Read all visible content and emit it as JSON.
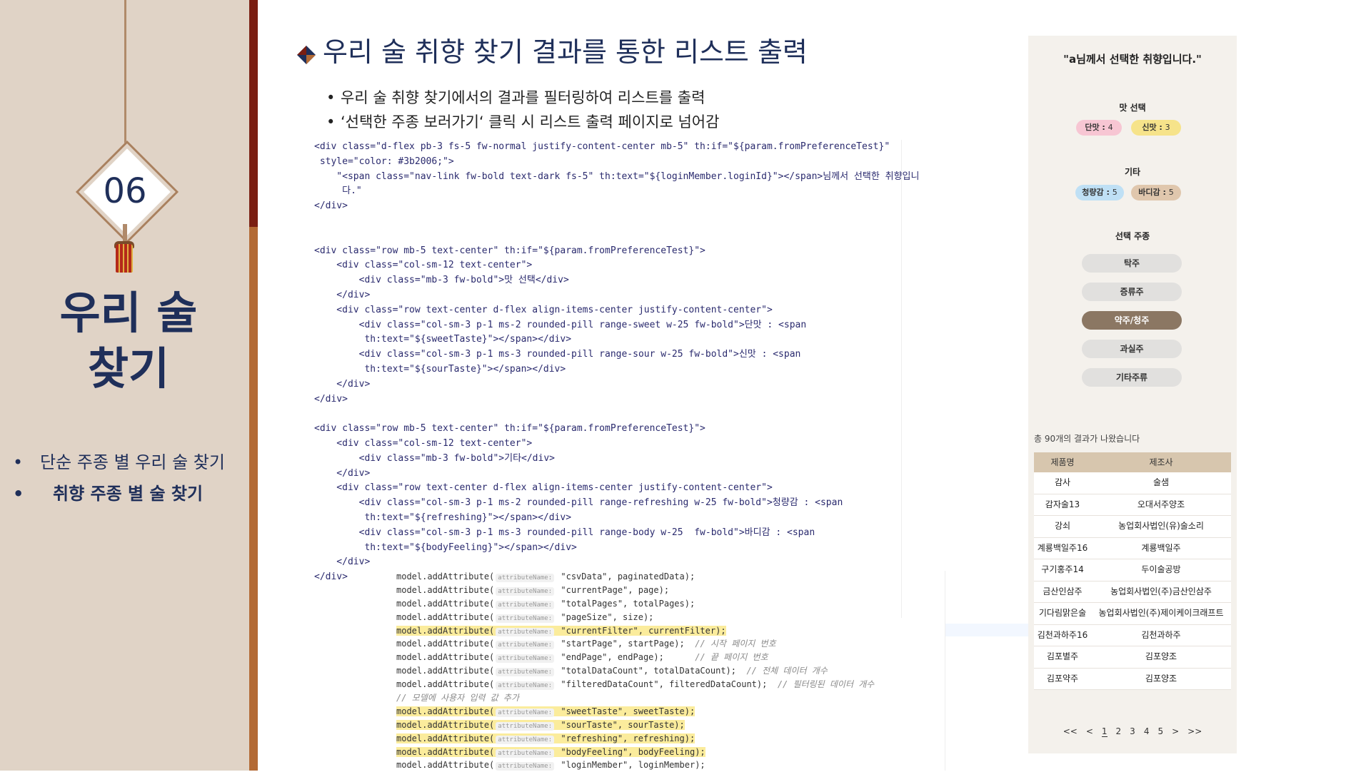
{
  "sidebar": {
    "badge": "06",
    "title_line1": "우리 술",
    "title_line2": "찾기",
    "menu": [
      {
        "label": "단순 주종 별 우리 술 찾기"
      },
      {
        "label": "취향 주종 별 술 찾기"
      }
    ]
  },
  "main": {
    "title": "우리 술 취향 찾기 결과를 통한 리스트 출력",
    "bullets": [
      "우리 술 취향 찾기에서의 결과를 필터링하여 리스트를 출력",
      "‘선택한 주종 보러가기‘ 클릭 시 리스트 출력 페이지로 넘어감"
    ]
  },
  "code_html": [
    "<div class=\"d-flex pb-3 fs-5 fw-normal justify-content-center mb-5\" th:if=\"${param.fromPreferenceTest}\"",
    " style=\"color: #3b2006;\">",
    "    \"<span class=\"nav-link fw-bold text-dark fs-5\" th:text=\"${loginMember.loginId}\"></span>님께서 선택한 취향입니",
    "     다.\"",
    "</div>",
    "",
    "",
    "<div class=\"row mb-5 text-center\" th:if=\"${param.fromPreferenceTest}\">",
    "    <div class=\"col-sm-12 text-center\">",
    "        <div class=\"mb-3 fw-bold\">맛 선택</div>",
    "    </div>",
    "    <div class=\"row text-center d-flex align-items-center justify-content-center\">",
    "        <div class=\"col-sm-3 p-1 ms-2 rounded-pill range-sweet w-25 fw-bold\">단맛 : <span",
    "         th:text=\"${sweetTaste}\"></span></div>",
    "        <div class=\"col-sm-3 p-1 ms-3 rounded-pill range-sour w-25 fw-bold\">신맛 : <span",
    "         th:text=\"${sourTaste}\"></span></div>",
    "    </div>",
    "</div>",
    "",
    "<div class=\"row mb-5 text-center\" th:if=\"${param.fromPreferenceTest}\">",
    "    <div class=\"col-sm-12 text-center\">",
    "        <div class=\"mb-3 fw-bold\">기타</div>",
    "    </div>",
    "    <div class=\"row text-center d-flex align-items-center justify-content-center\">",
    "        <div class=\"col-sm-3 p-1 ms-2 rounded-pill range-refreshing w-25 fw-bold\">청량감 : <span",
    "         th:text=\"${refreshing}\"></span></div>",
    "        <div class=\"col-sm-3 p-1 ms-3 rounded-pill range-body w-25  fw-bold\">바디감 : <span",
    "         th:text=\"${bodyFeeling}\"></span></div>",
    "    </div>",
    "</div>"
  ],
  "code_java": [
    {
      "pre": "model.addAttribute(",
      "tag": "attributeName:",
      "post": " \"csvData\", paginatedData);",
      "hl": false,
      "comment": ""
    },
    {
      "pre": "model.addAttribute(",
      "tag": "attributeName:",
      "post": " \"currentPage\", page);",
      "hl": false,
      "comment": ""
    },
    {
      "pre": "model.addAttribute(",
      "tag": "attributeName:",
      "post": " \"totalPages\", totalPages);",
      "hl": false,
      "comment": ""
    },
    {
      "pre": "model.addAttribute(",
      "tag": "attributeName:",
      "post": " \"pageSize\", size);",
      "hl": false,
      "comment": ""
    },
    {
      "pre": "model.addAttribute(",
      "tag": "attributeName:",
      "post": " \"currentFilter\", currentFilter);",
      "hl": true,
      "comment": ""
    },
    {
      "pre": "model.addAttribute(",
      "tag": "attributeName:",
      "post": " \"startPage\", startPage);  ",
      "hl": false,
      "comment": "// 시작 페이지 번호"
    },
    {
      "pre": "model.addAttribute(",
      "tag": "attributeName:",
      "post": " \"endPage\", endPage);      ",
      "hl": false,
      "comment": "// 끝 페이지 번호"
    },
    {
      "pre": "model.addAttribute(",
      "tag": "attributeName:",
      "post": " \"totalDataCount\", totalDataCount);  ",
      "hl": false,
      "comment": "// 전체 데이터 개수"
    },
    {
      "pre": "model.addAttribute(",
      "tag": "attributeName:",
      "post": " \"filteredDataCount\", filteredDataCount);  ",
      "hl": false,
      "comment": "// 필터링된 데이터 개수"
    },
    {
      "pre": "",
      "tag": "",
      "post": "",
      "hl": false,
      "comment": "// 모델에 사용자 입력 값 추가"
    },
    {
      "pre": "model.addAttribute(",
      "tag": "attributeName:",
      "post": " \"sweetTaste\", sweetTaste);",
      "hl": true,
      "comment": ""
    },
    {
      "pre": "model.addAttribute(",
      "tag": "attributeName:",
      "post": " \"sourTaste\", sourTaste);",
      "hl": true,
      "comment": ""
    },
    {
      "pre": "model.addAttribute(",
      "tag": "attributeName:",
      "post": " \"refreshing\", refreshing);",
      "hl": true,
      "comment": ""
    },
    {
      "pre": "model.addAttribute(",
      "tag": "attributeName:",
      "post": " \"bodyFeeling\", bodyFeeling);",
      "hl": true,
      "comment": ""
    },
    {
      "pre": "model.addAttribute(",
      "tag": "attributeName:",
      "post": " \"loginMember\", loginMember);",
      "hl": false,
      "comment": ""
    }
  ],
  "screenshot": {
    "header": "\"a님께서 선택한 취향입니다.\"",
    "taste_label": "맛 선택",
    "sweet": {
      "label": "단맛 : ",
      "value": "4",
      "color": "#f7c6d3"
    },
    "sour": {
      "label": "신맛 : ",
      "value": "3",
      "color": "#f6e38a"
    },
    "etc_label": "기타",
    "refreshing": {
      "label": "청량감 : ",
      "value": "5",
      "color": "#bfe0f5"
    },
    "body": {
      "label": "바디감 : ",
      "value": "5",
      "color": "#e0c7ad"
    },
    "type_label": "선택 주종",
    "types": [
      {
        "label": "탁주",
        "selected": false
      },
      {
        "label": "증류주",
        "selected": false
      },
      {
        "label": "약주/청주",
        "selected": true
      },
      {
        "label": "과실주",
        "selected": false
      },
      {
        "label": "기타주류",
        "selected": false
      }
    ],
    "count_text": "총 90개의 결과가 나왔습니다",
    "table_headers": [
      "제품명",
      "제조사"
    ],
    "rows": [
      [
        "감사",
        "술샘"
      ],
      [
        "감자술13",
        "오대서주양조"
      ],
      [
        "강쇠",
        "농업회사법인(유)술소리"
      ],
      [
        "계룡백일주16",
        "계룡백일주"
      ],
      [
        "구기홍주14",
        "두이술공방"
      ],
      [
        "금산인삼주",
        "농업회사법인(주)금산인삼주"
      ],
      [
        "기다림맑은술",
        "농업회사법인(주)제이케이크래프트"
      ],
      [
        "김천과하주16",
        "김천과하주"
      ],
      [
        "김포별주",
        "김포양조"
      ],
      [
        "김포약주",
        "김포양조"
      ]
    ],
    "pager": [
      "<<",
      "<",
      "1",
      "2",
      "3",
      "4",
      "5",
      ">",
      ">>"
    ],
    "current_page": "1"
  }
}
